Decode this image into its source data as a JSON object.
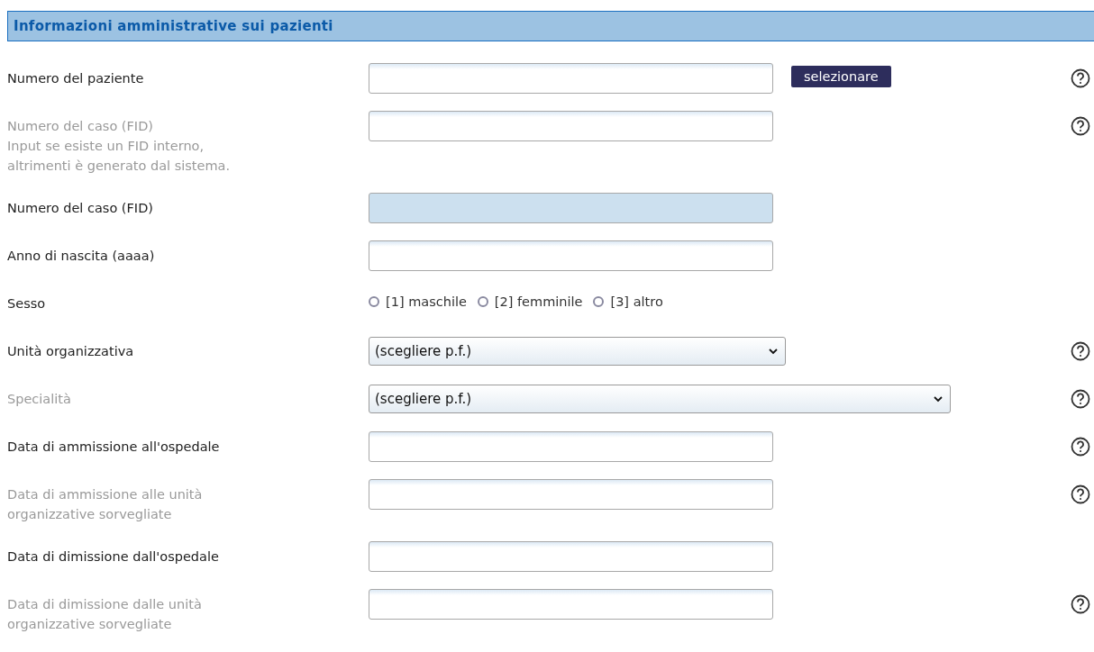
{
  "section_title": "Informazioni amministrative sui pazienti",
  "rows": [
    {
      "kind": "input",
      "label": "Numero del paziente",
      "muted": false,
      "readonly": false,
      "button": "selezionare",
      "help": true
    },
    {
      "kind": "input",
      "label": "Numero del caso (FID)\nInput se esiste un FID interno,\naltrimenti è generato dal sistema.",
      "muted": true,
      "readonly": false,
      "help": true
    },
    {
      "kind": "input",
      "label": "Numero del caso (FID)",
      "muted": false,
      "readonly": true,
      "help": false
    },
    {
      "kind": "input",
      "label": "Anno di nascita (aaaa)",
      "muted": false,
      "readonly": false,
      "help": false
    },
    {
      "kind": "radio",
      "label": "Sesso",
      "muted": false,
      "help": false,
      "options": [
        {
          "label": "[1] maschile",
          "selected": false
        },
        {
          "label": "[2] femminile",
          "selected": false
        },
        {
          "label": "[3] altro",
          "selected": false
        }
      ]
    },
    {
      "kind": "select",
      "label": "Unità organizzativa",
      "muted": false,
      "wide": false,
      "value": "(scegliere p.f.)",
      "help": true
    },
    {
      "kind": "select",
      "label": "Specialità",
      "muted": true,
      "wide": true,
      "value": "(scegliere p.f.)",
      "help": true
    },
    {
      "kind": "input",
      "label": "Data di ammissione all'ospedale",
      "muted": false,
      "readonly": false,
      "help": true
    },
    {
      "kind": "input",
      "label": "Data di ammissione alle unità\norganizzative sorvegliate",
      "muted": true,
      "readonly": false,
      "help": true
    },
    {
      "kind": "input",
      "label": "Data di dimissione dall'ospedale",
      "muted": false,
      "readonly": false,
      "help": false
    },
    {
      "kind": "input",
      "label": "Data di dimissione dalle unità\norganizzative sorvegliate",
      "muted": true,
      "readonly": false,
      "help": true
    }
  ]
}
